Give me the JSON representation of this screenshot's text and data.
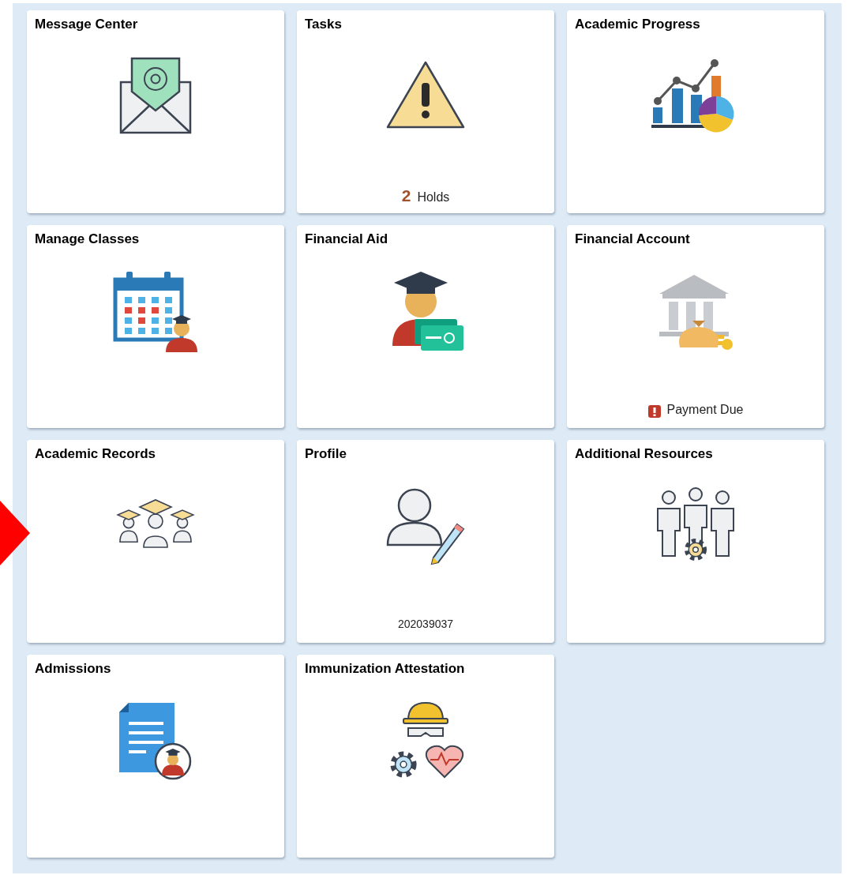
{
  "pointer": {
    "kind": "arrow"
  },
  "tiles": [
    {
      "title": "Message Center"
    },
    {
      "title": "Tasks",
      "footer": {
        "kind": "count",
        "count": "2",
        "label": "Holds"
      }
    },
    {
      "title": "Academic Progress"
    },
    {
      "title": "Manage Classes"
    },
    {
      "title": "Financial Aid"
    },
    {
      "title": "Financial Account",
      "footer": {
        "kind": "alert",
        "label": "Payment Due"
      }
    },
    {
      "title": "Academic Records"
    },
    {
      "title": "Profile",
      "footer": {
        "kind": "text",
        "label": "202039037"
      }
    },
    {
      "title": "Additional Resources"
    },
    {
      "title": "Admissions"
    },
    {
      "title": "Immunization Attestation"
    }
  ]
}
